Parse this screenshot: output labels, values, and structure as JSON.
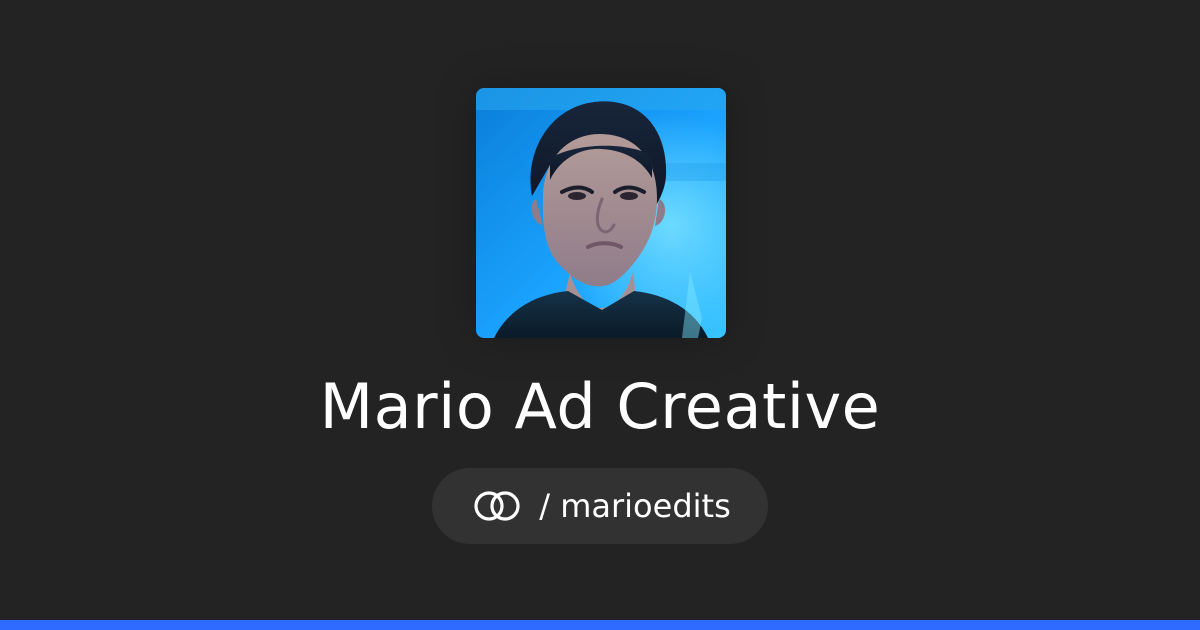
{
  "profile": {
    "name": "Mario Ad Creative",
    "handle": "/ marioedits",
    "logo_icon": "linked-rings-icon",
    "avatar_alt": "profile photo"
  },
  "colors": {
    "background": "#232323",
    "pill_background": "#323232",
    "accent": "#2f6bff",
    "text": "#ffffff"
  }
}
